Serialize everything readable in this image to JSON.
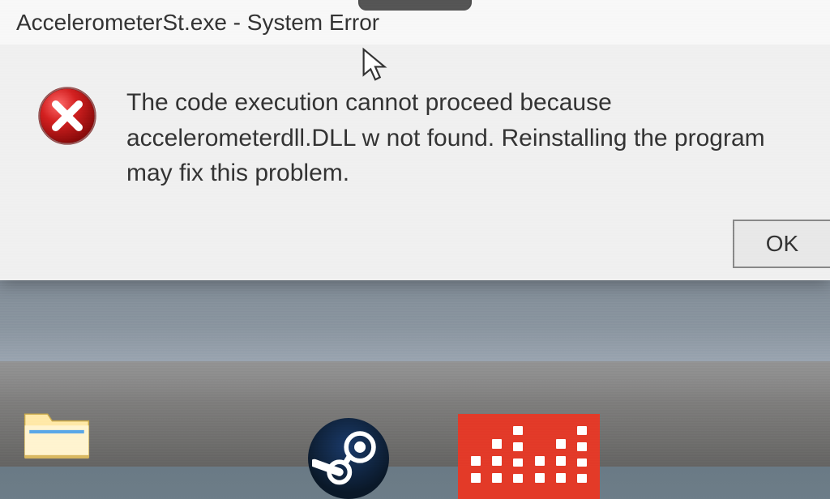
{
  "dialog": {
    "title": "AccelerometerSt.exe - System Error",
    "message": "The code execution cannot proceed because accelerometerdll.DLL w not found. Reinstalling the program may fix this problem.",
    "ok_label": "OK"
  },
  "icons": {
    "error": "error-icon",
    "cursor": "arrow-cursor",
    "folder": "file-explorer-icon",
    "steam": "steam-icon",
    "equalizer": "equalizer-icon"
  }
}
